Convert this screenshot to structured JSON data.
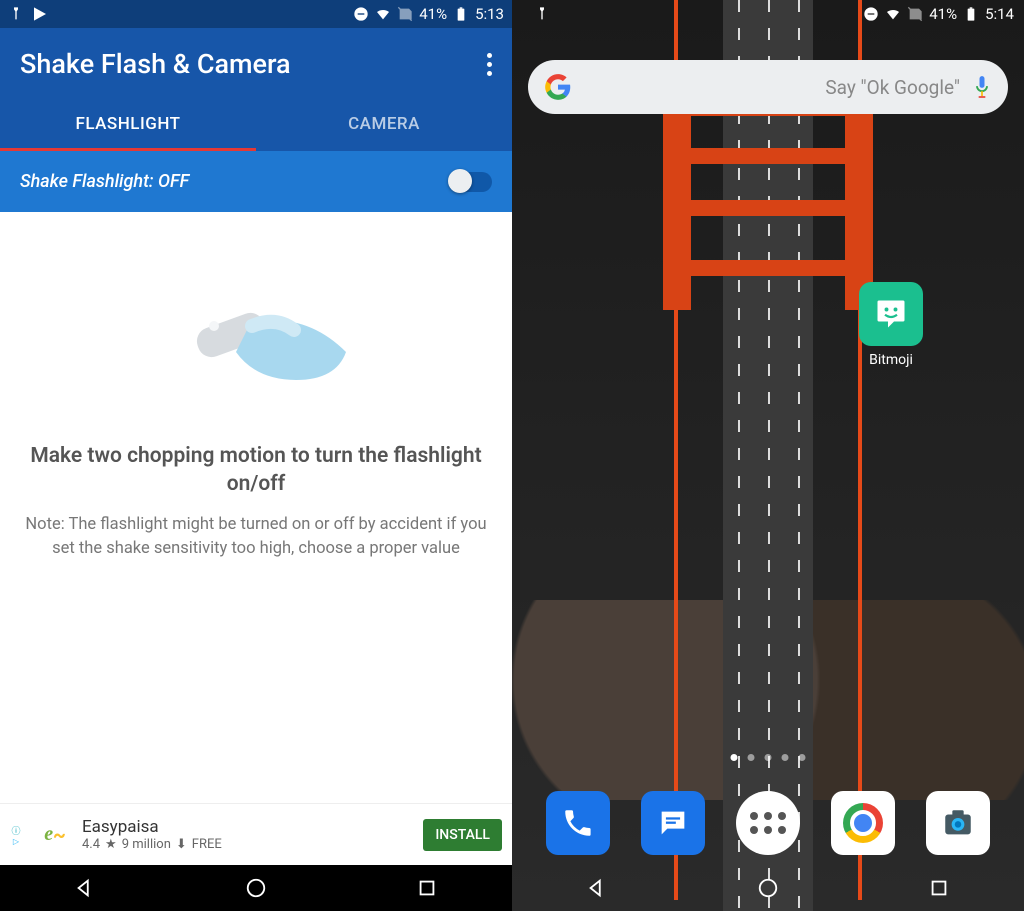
{
  "phone1": {
    "status": {
      "battery": "41%",
      "time": "5:13"
    },
    "title": "Shake Flash & Camera",
    "tabs": {
      "flashlight": "FLASHLIGHT",
      "camera": "CAMERA"
    },
    "toggle_label": "Shake Flashlight: OFF",
    "heading": "Make two chopping motion to turn the flashlight on/off",
    "note": "Note: The flashlight might be turned on or off by accident if you set the shake sensitivity too high, choose a proper value",
    "ad": {
      "name": "Easypaisa",
      "rating": "4.4",
      "downloads": "9 million",
      "price": "FREE",
      "cta": "INSTALL"
    }
  },
  "phone2": {
    "status": {
      "battery": "41%",
      "time": "5:14"
    },
    "search_placeholder": "Say \"Ok Google\"",
    "app": {
      "name": "Bitmoji"
    },
    "page_indicator": {
      "total": 5,
      "active": 0
    }
  }
}
